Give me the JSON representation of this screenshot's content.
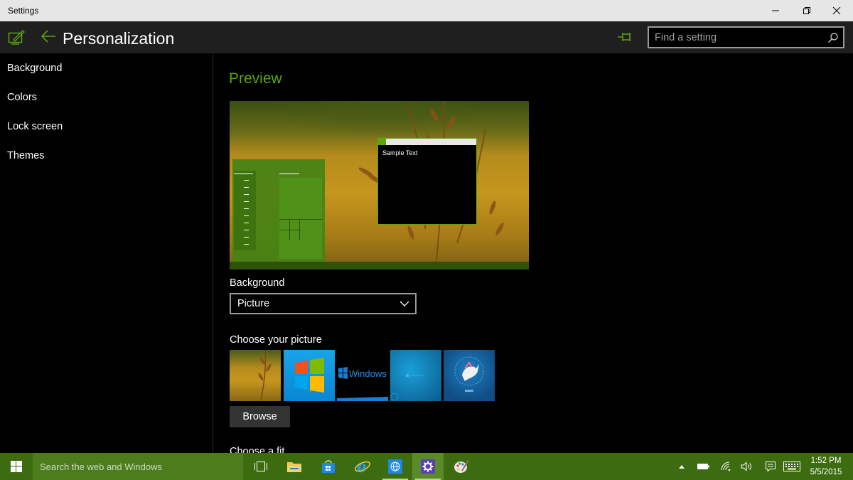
{
  "window": {
    "title": "Settings",
    "minimize_label": "Minimize",
    "restore_label": "Restore",
    "close_label": "Close"
  },
  "header": {
    "page_title": "Personalization",
    "search_placeholder": "Find a setting"
  },
  "sidebar": {
    "items": [
      {
        "label": "Background"
      },
      {
        "label": "Colors"
      },
      {
        "label": "Lock screen"
      },
      {
        "label": "Themes"
      }
    ]
  },
  "main": {
    "preview_title": "Preview",
    "preview_sample_text": "Sample Text",
    "background_label": "Background",
    "background_value": "Picture",
    "choose_picture_label": "Choose your picture",
    "thumbnails": [
      {
        "name": "wheat-field"
      },
      {
        "name": "windows-logo-blue"
      },
      {
        "name": "windows-wordmark",
        "text": "Windows"
      },
      {
        "name": "windows-blue-glow"
      },
      {
        "name": "windows-unicorn"
      }
    ],
    "browse_label": "Browse",
    "choose_fit_label": "Choose a fit"
  },
  "taskbar": {
    "search_placeholder": "Search the web and Windows",
    "time": "1:52 PM",
    "date": "5/5/2015"
  },
  "colors": {
    "accent": "#5ea40c",
    "taskbar": "#3d6b10",
    "header_bg": "#1f1f1f"
  }
}
